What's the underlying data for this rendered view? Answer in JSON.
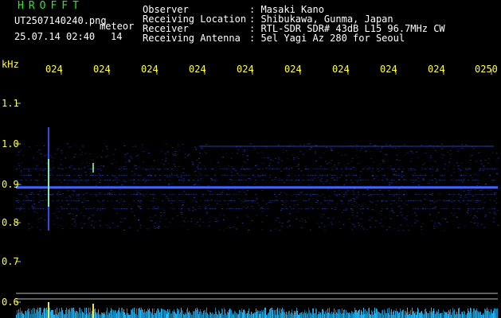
{
  "header": {
    "app_title": "HROFFT",
    "filename": "UT2507140240.png",
    "event_label": "meteor",
    "datetime": "25.07.14 02:40",
    "count": "14",
    "info": [
      {
        "label": "Observer",
        "value": ": Masaki Kano"
      },
      {
        "label": "Receiving Location",
        "value": ": Shibukawa, Gunma, Japan"
      },
      {
        "label": "Receiver",
        "value": ": RTL-SDR SDR# 43dB L15 96.7MHz CW"
      },
      {
        "label": "Receiving Antenna",
        "value": ": 5el Yagi Az 280 for Seoul"
      }
    ]
  },
  "axes": {
    "y_unit": "kHz",
    "y_ticks": [
      "1.1",
      "1.0",
      "0.9",
      "0.8",
      "0.7",
      "0.6"
    ],
    "x_ticks": [
      "024",
      "024",
      "024",
      "024",
      "024",
      "024",
      "024",
      "024",
      "024",
      "0250"
    ]
  },
  "colors": {
    "title": "#22ee22",
    "text": "#ffffff",
    "axis_labels": "#ffff44",
    "signal": "#3355ff",
    "grid": "#bbbbbb",
    "baseline_noise": "#22bbff",
    "meteor_trace": "#88ffaa"
  }
}
